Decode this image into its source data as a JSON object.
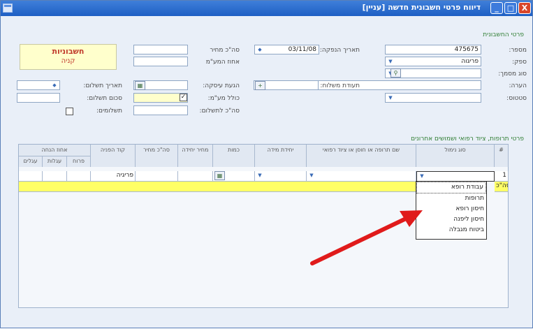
{
  "window": {
    "title": "דיווח פרטי חשבונית חדשה [עניין]",
    "btn_close": "X",
    "btn_max": "□",
    "btn_min": "_"
  },
  "section_invoice": "פרטי החשבונית",
  "section_items": "פרטי תרופות, ציוד רפואי ושמושים אחרונים",
  "labels": {
    "number": "מספר:",
    "supplier": "ספק:",
    "doc_type": "סוג מסמך:",
    "note": "הערה:",
    "status": "סטטוס:",
    "issue_date": "תאריך הנפקה:",
    "order_total": "סה\"כ מחיר",
    "vat_pct": "אחוז המע\"מ",
    "supply_date": "הגעת עיסקה:",
    "paid_vat": "כולל מע\"מ:",
    "total_to_pay": "סה\"כ לתשלום:",
    "payment_date": "תאריך תשלום:",
    "payment_amount": "סכום תשלום:",
    "payments": "תשלומים:",
    "delivery_certificate": "תעודת משלוח:"
  },
  "fields": {
    "number": "475675",
    "supplier": "פריגוה",
    "issue_date": "03/11/08",
    "paid_vat_checked": "✓",
    "payments_checked": ""
  },
  "badge": {
    "title": "חשבוניות",
    "subtitle": "קניה"
  },
  "grid": {
    "headers": [
      "#",
      "סוג נימול",
      "שם תרופה או חוסן או ציוד רפואי",
      "יחידת מידה",
      "כמות",
      "מחיר יחידה",
      "סה\"כ מחיר",
      "קוד הפניה"
    ],
    "group_header": "אחוז הנחה",
    "sub_headers": [
      "פרוח",
      "עגלות",
      "עגלים"
    ],
    "row1": {
      "index": "1",
      "code_ref": "פריגיה"
    },
    "total_row_label": "סה\"כ"
  },
  "dropdown_options": [
    "עבודת רופא",
    "תרופות",
    "חיסון רופא",
    "חיסון ליפנה",
    "ביטוח מגבלה"
  ],
  "colors": {
    "titlebar": "#1e5fc4",
    "section_text": "#2e7d32",
    "badge_text": "#c0392b",
    "highlight_row": "#ffff66",
    "arrow": "#e01b1b"
  }
}
